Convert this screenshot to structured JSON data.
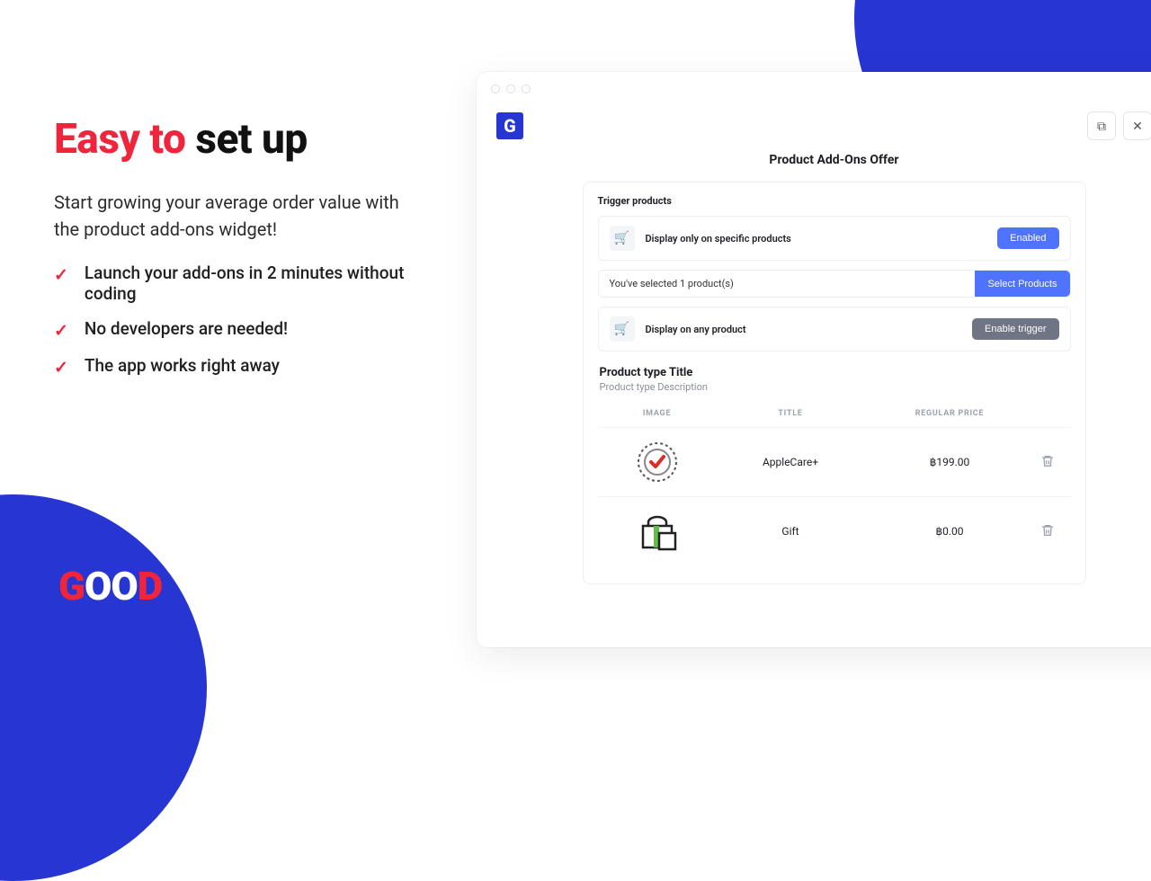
{
  "marketing": {
    "headline_accent": "Easy to",
    "headline_rest": "set up",
    "subhead": "Start growing your average order value with the product add-ons widget!",
    "bullets": [
      "Launch your add-ons in 2 minutes without coding",
      "No developers are needed!",
      "The app works right away"
    ],
    "logo_text": "GOOD"
  },
  "app": {
    "brand_letter": "G",
    "page_title": "Product Add-Ons Offer",
    "trigger_section_label": "Trigger products",
    "triggers": [
      {
        "label": "Display only on specific products",
        "button": "Enabled",
        "style": "enabled"
      },
      {
        "label": "Display on any product",
        "button": "Enable trigger",
        "style": "gray"
      }
    ],
    "selected_info": "You've selected 1 product(s)",
    "select_products_label": "Select Products",
    "product_type_title": "Product type Title",
    "product_type_desc": "Product type Description",
    "columns": {
      "image": "Image",
      "title": "Title",
      "price": "Regular Price"
    },
    "rows": [
      {
        "icon": "badge",
        "title": "AppleCare+",
        "price": "฿199.00"
      },
      {
        "icon": "gift",
        "title": "Gift",
        "price": "฿0.00"
      }
    ],
    "close_symbol": "✕",
    "duplicate_symbol": "⧉"
  }
}
